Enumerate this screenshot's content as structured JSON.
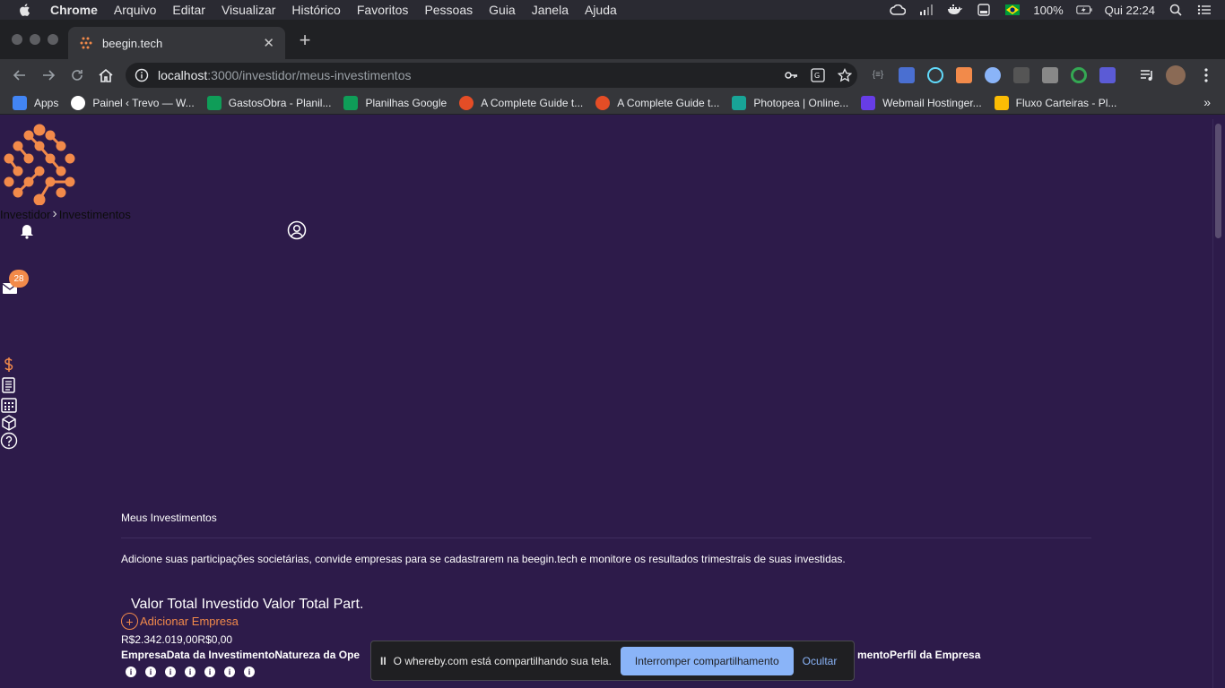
{
  "menubar": {
    "app": "Chrome",
    "items": [
      "Arquivo",
      "Editar",
      "Visualizar",
      "Histórico",
      "Favoritos",
      "Pessoas",
      "Guia",
      "Janela",
      "Ajuda"
    ],
    "battery": "100%",
    "clock": "Qui 22:24"
  },
  "tab": {
    "title": "beegin.tech"
  },
  "omnibox": {
    "host": "localhost",
    "path": ":3000/investidor/meus-investimentos"
  },
  "bookmarks": [
    {
      "label": "Apps",
      "color": "#4285f4"
    },
    {
      "label": "Painel ‹ Trevo — W...",
      "color": "#ffffff"
    },
    {
      "label": "GastosObra - Planil...",
      "color": "#0f9d58"
    },
    {
      "label": "Planilhas Google",
      "color": "#0f9d58"
    },
    {
      "label": "A Complete Guide t...",
      "color": "#e44d26"
    },
    {
      "label": "A Complete Guide t...",
      "color": "#e44d26"
    },
    {
      "label": "Photopea | Online...",
      "color": "#18a497"
    },
    {
      "label": "Webmail Hostinger...",
      "color": "#673de6"
    },
    {
      "label": "Fluxo Carteiras - Pl...",
      "color": "#fbbc04"
    }
  ],
  "breadcrumb": {
    "first": "Investidor",
    "second": "Investimentos"
  },
  "notifications": {
    "mail_count": "28"
  },
  "content": {
    "section_title": "Meus Investimentos",
    "description": "Adicione suas participações societárias, convide empresas para se cadastrarem na beegin.tech e monitore os resultados trimestrais de suas investidas.",
    "totals_header": "Valor Total Investido Valor Total Part.",
    "add_company": "Adicionar Empresa",
    "totals_values": "R$2.342.019,00R$0,00",
    "table_header_left": "EmpresaData da InvestimentoNatureza da Ope",
    "table_header_right": "mentoPerfil da Empresa",
    "info_count": 7
  },
  "sharebar": {
    "pause": "II",
    "message": "O whereby.com está compartilhando sua tela.",
    "stop": "Interromper compartilhamento",
    "hide": "Ocultar"
  },
  "colors": {
    "page_bg": "#2d1b4a",
    "accent": "#f28a4a",
    "share_button": "#8ab4f8"
  }
}
